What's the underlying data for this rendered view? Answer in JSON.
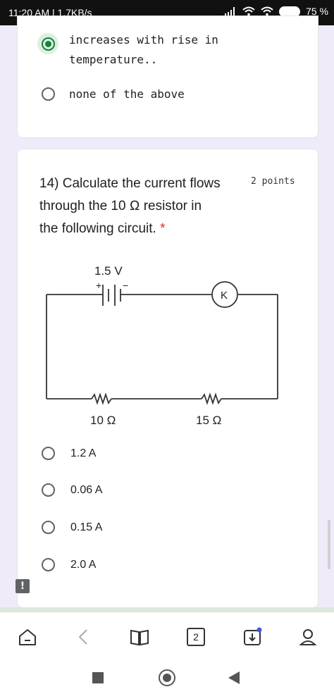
{
  "status": {
    "time": "11:20 AM | 1.7KB/s",
    "battery": "75 %"
  },
  "prev_question": {
    "options": [
      {
        "label_line1": "increases with rise in",
        "label_line2": "temperature..",
        "selected": true
      },
      {
        "label_line1": "none of the above",
        "selected": false
      }
    ]
  },
  "question": {
    "number_title": "14) Calculate the current flows",
    "title_line2": "through the 10 Ω resistor in",
    "title_line3": "the following circuit.",
    "required_mark": "*",
    "points": "2 points",
    "circuit": {
      "battery_label": "1.5 V",
      "plus": "+",
      "minus": "−",
      "key_label": "K",
      "r1_label": "10 Ω",
      "r2_label": "15 Ω"
    },
    "options": [
      {
        "label": "1.2 A"
      },
      {
        "label": "0.06 A"
      },
      {
        "label": "0.15 A"
      },
      {
        "label": "2.0 A"
      }
    ]
  },
  "browser_bar": {
    "tabs_count": "2",
    "icons": [
      "home-icon",
      "back-icon",
      "reader-icon",
      "tabs-icon",
      "downloads-icon",
      "profile-icon"
    ]
  },
  "nav_bar": {
    "icons": [
      "recents-icon",
      "home-circle-icon",
      "back-triangle-icon"
    ]
  },
  "colors": {
    "accent_green": "#188038",
    "page_bg": "#f0ebf8",
    "required_red": "#d93025"
  }
}
